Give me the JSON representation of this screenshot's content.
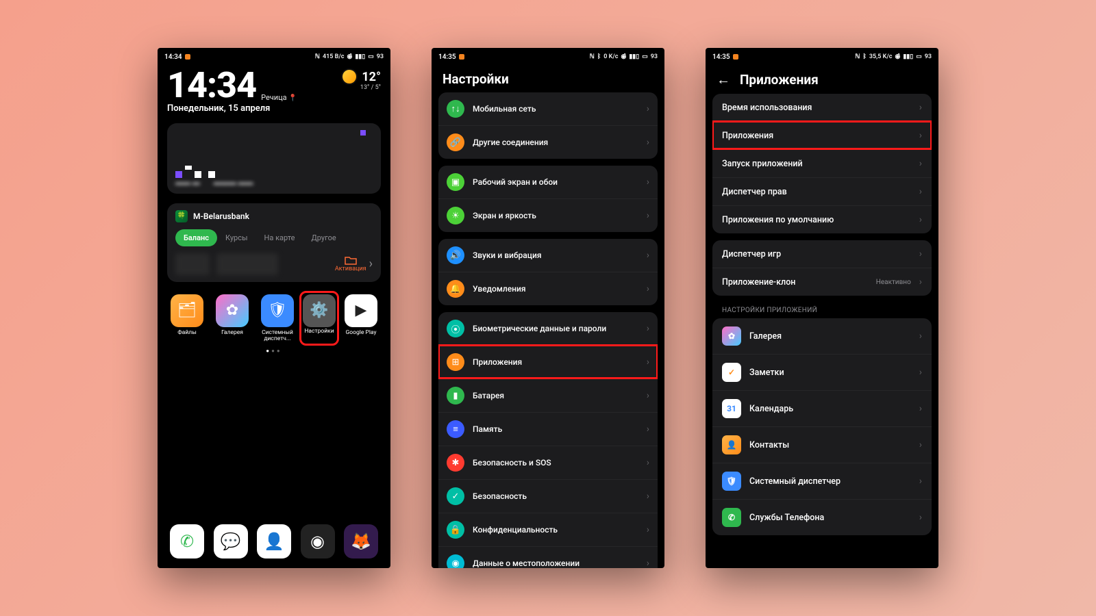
{
  "screen1": {
    "status": {
      "time": "14:34",
      "net": "415 B/c",
      "battery": "93"
    },
    "clock": {
      "time": "14:34",
      "city": "Речица",
      "date": "Понедельник, 15 апреля"
    },
    "weather": {
      "temp": "12°",
      "range": "13° / 5°"
    },
    "bank": {
      "name": "M-Belarusbank",
      "tabs": [
        "Баланс",
        "Курсы",
        "На карте",
        "Другое"
      ],
      "activate": "Активация"
    },
    "apps": [
      "Файлы",
      "Галерея",
      "Системный диспетч...",
      "Настройки",
      "Google Play"
    ]
  },
  "screen2": {
    "status": {
      "time": "14:35",
      "net": "0 K/c",
      "battery": "93"
    },
    "title": "Настройки",
    "groups": [
      [
        {
          "label": "Мобильная сеть",
          "color": "bg-green",
          "glyph": "↑↓"
        },
        {
          "label": "Другие соединения",
          "color": "bg-orange",
          "glyph": "🔗"
        }
      ],
      [
        {
          "label": "Рабочий экран и обои",
          "color": "bg-lime",
          "glyph": "▣"
        },
        {
          "label": "Экран и яркость",
          "color": "bg-lime",
          "glyph": "☀"
        }
      ],
      [
        {
          "label": "Звуки и вибрация",
          "color": "bg-blue",
          "glyph": "🔊"
        },
        {
          "label": "Уведомления",
          "color": "bg-orange",
          "glyph": "🔔"
        }
      ],
      [
        {
          "label": "Биометрические данные и пароли",
          "color": "bg-teal",
          "glyph": "⦿"
        },
        {
          "label": "Приложения",
          "color": "bg-orange",
          "glyph": "⊞",
          "highlight": true
        },
        {
          "label": "Батарея",
          "color": "bg-green",
          "glyph": "▮"
        },
        {
          "label": "Память",
          "color": "bg-dkblue",
          "glyph": "≡"
        },
        {
          "label": "Безопасность и SOS",
          "color": "bg-red",
          "glyph": "✱"
        },
        {
          "label": "Безопасность",
          "color": "bg-teal",
          "glyph": "✓"
        },
        {
          "label": "Конфиденциальность",
          "color": "bg-teal",
          "glyph": "🔒"
        },
        {
          "label": "Данные о местоположении",
          "color": "bg-cyan",
          "glyph": "◉"
        }
      ]
    ]
  },
  "screen3": {
    "status": {
      "time": "14:35",
      "net": "35,5 K/c",
      "battery": "93"
    },
    "title": "Приложения",
    "group1": [
      {
        "label": "Время использования"
      },
      {
        "label": "Приложения",
        "highlight": true
      },
      {
        "label": "Запуск приложений"
      },
      {
        "label": "Диспетчер прав"
      },
      {
        "label": "Приложения по умолчанию"
      }
    ],
    "group2": [
      {
        "label": "Диспетчер игр"
      },
      {
        "label": "Приложение-клон",
        "meta": "Неактивно"
      }
    ],
    "sectionLabel": "НАСТРОЙКИ ПРИЛОЖЕНИЙ",
    "appList": [
      {
        "label": "Галерея",
        "bg": "linear-gradient(135deg,#ff6ec7,#45caff)",
        "glyph": "✿"
      },
      {
        "label": "Заметки",
        "bg": "#fff",
        "glyph": "✓",
        "fg": "#ff8c1a"
      },
      {
        "label": "Календарь",
        "bg": "#fff",
        "glyph": "31",
        "fg": "#3b8bff"
      },
      {
        "label": "Контакты",
        "bg": "linear-gradient(135deg,#ffb347,#ff8c1a)",
        "glyph": "👤"
      },
      {
        "label": "Системный диспетчер",
        "bg": "#3b8bff",
        "glyph": "🛡"
      },
      {
        "label": "Службы Телефона",
        "bg": "#2fb84e",
        "glyph": "✆"
      }
    ]
  }
}
